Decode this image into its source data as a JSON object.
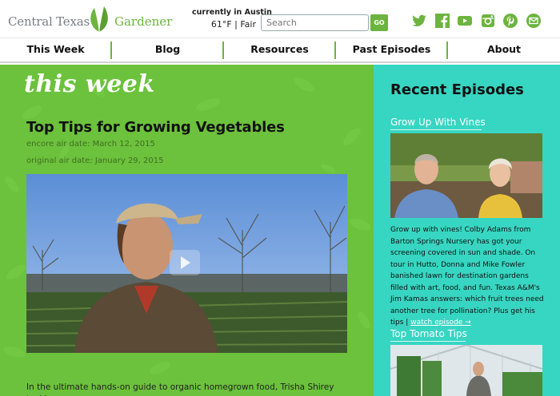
{
  "site": {
    "logo_left": "Central Texas",
    "logo_right": "Gardener"
  },
  "weather": {
    "label": "currently in Austin",
    "reading": "61°F | Fair"
  },
  "search": {
    "placeholder": "Search",
    "button_label": "GO"
  },
  "social_icons": [
    "twitter-icon",
    "facebook-icon",
    "youtube-icon",
    "instagram-icon",
    "pinterest-icon",
    "email-icon"
  ],
  "nav": {
    "items": [
      {
        "label": "This Week"
      },
      {
        "label": "Blog"
      },
      {
        "label": "Resources"
      },
      {
        "label": "Past Episodes"
      },
      {
        "label": "About"
      }
    ]
  },
  "main": {
    "section_heading": "this week",
    "article_title": "Top Tips for Growing Vegetables",
    "encore_date": "encore air date: March 12, 2015",
    "original_date": "original air date: January 29, 2015",
    "body_text": "In the ultimate hands-on guide to organic homegrown food, Trisha Shirey tackles"
  },
  "sidebar": {
    "title": "Recent Episodes",
    "episodes": [
      {
        "title": "Grow Up With Vines",
        "description": "Grow up with vines! Colby Adams from Barton Springs Nursery has got your screening covered in sun and shade. On tour in Hutto, Donna and Mike Fowler banished lawn for destination gardens filled with art, food, and fun. Texas A&M's Jim Kamas answers: which fruit trees need another tree for pollination? Plus get his tips |",
        "link_text": "watch episode →"
      },
      {
        "title": "Top Tomato Tips"
      }
    ]
  },
  "colors": {
    "brand_green": "#6cb43f",
    "main_bg": "#6cc23c",
    "sidebar_bg": "#37d6c2"
  }
}
